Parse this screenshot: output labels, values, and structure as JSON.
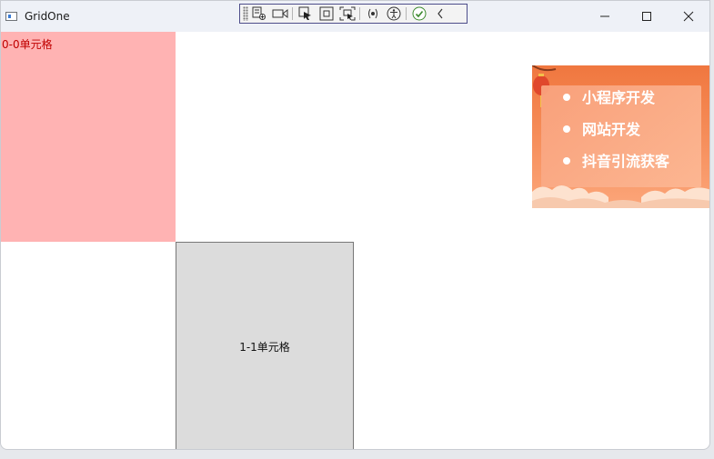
{
  "window": {
    "title": "GridOne"
  },
  "debug_toolbar": {
    "buttons": [
      "select-element-icon",
      "record-icon",
      "pointer-select-icon",
      "display-layout-icon",
      "track-focus-icon",
      "binding-failures-icon",
      "accessibility-icon",
      "check-icon",
      "collapse-chevron-icon"
    ]
  },
  "grid": {
    "cell_0_0": {
      "label": "0-0单元格",
      "color": "#ffb3b3",
      "text_color": "#c00000"
    },
    "cell_1_1": {
      "label": "1-1单元格",
      "color": "#dcdcdc"
    }
  },
  "banner": {
    "items": [
      "小程序开发",
      "网站开发",
      "抖音引流获客"
    ],
    "accent": "#f0773f"
  }
}
